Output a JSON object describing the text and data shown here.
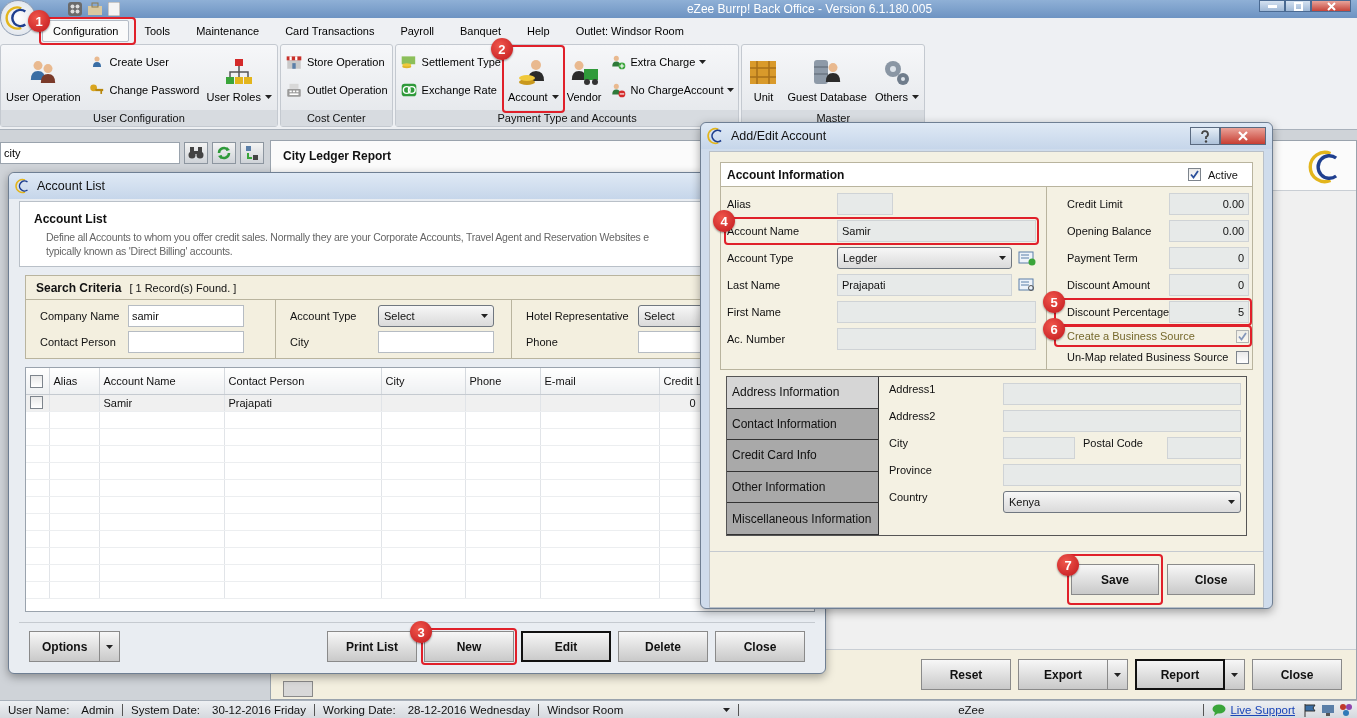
{
  "window": {
    "title": "eZee Burrp! Back Office - Version 6.1.180.005"
  },
  "menu": [
    {
      "label": "Configuration",
      "selected": true,
      "callout": "1"
    },
    {
      "label": "Tools",
      "selected": false
    },
    {
      "label": "Maintenance",
      "selected": false
    },
    {
      "label": "Card Transactions",
      "selected": false
    },
    {
      "label": "Payroll",
      "selected": false
    },
    {
      "label": "Banquet",
      "selected": false
    },
    {
      "label": "Help",
      "selected": false
    },
    {
      "label": "Outlet: Windsor Room",
      "selected": false
    }
  ],
  "ribbon": [
    {
      "title": "User Configuration",
      "items": [
        {
          "label": "User Operation",
          "kind": "large",
          "dropdown": false
        },
        {
          "label": "Create User",
          "kind": "small",
          "dropdown": false
        },
        {
          "label": "Change Password",
          "kind": "small",
          "dropdown": false
        },
        {
          "label": "User Roles",
          "kind": "large",
          "dropdown": true
        }
      ]
    },
    {
      "title": "Cost Center",
      "items": [
        {
          "label": "Store Operation",
          "kind": "small",
          "dropdown": false
        },
        {
          "label": "Outlet Operation",
          "kind": "small",
          "dropdown": false
        }
      ]
    },
    {
      "title": "Payment Type and Accounts",
      "items": [
        {
          "label": "Settlement Type",
          "kind": "small",
          "dropdown": false
        },
        {
          "label": "Exchange Rate",
          "kind": "small",
          "dropdown": false
        },
        {
          "label": "Account",
          "kind": "large",
          "dropdown": true,
          "callout": "2"
        },
        {
          "label": "Vendor",
          "kind": "large",
          "dropdown": false
        },
        {
          "label": "Extra Charge",
          "kind": "small",
          "dropdown": true
        },
        {
          "label": "No ChargeAccount",
          "kind": "small",
          "dropdown": true
        }
      ]
    },
    {
      "title": "Master",
      "items": [
        {
          "label": "Unit",
          "kind": "large",
          "dropdown": false
        },
        {
          "label": "Guest Database",
          "kind": "large",
          "dropdown": false
        },
        {
          "label": "Others",
          "kind": "large",
          "dropdown": true
        }
      ]
    }
  ],
  "search": {
    "value": "city"
  },
  "report_panel": {
    "title": "City Ledger Report",
    "buttons": [
      {
        "label": "Reset",
        "split": false,
        "focused": false
      },
      {
        "label": "Export",
        "split": true,
        "focused": false
      },
      {
        "label": "Report",
        "split": true,
        "focused": true
      },
      {
        "label": "Close",
        "split": false,
        "focused": false
      }
    ]
  },
  "account_list": {
    "title": "Account List",
    "heading": "Account List",
    "description_lines": [
      "Define all Accounts to whom you offer credit sales. Normally they are your Corporate Accounts, Travel Agent and Reservation Websites e",
      "typically known as 'Direct Billing' accounts."
    ],
    "search_criteria": {
      "title": "Search Criteria",
      "count": "[ 1 Record(s) Found. ]",
      "fields": [
        {
          "label": "Company Name",
          "value": "samir",
          "kind": "text"
        },
        {
          "label": "Account Type",
          "value": "Select",
          "kind": "select"
        },
        {
          "label": "Hotel Representative",
          "value": "Select",
          "kind": "select"
        },
        {
          "label": "Contact Person",
          "kind": "text"
        },
        {
          "label": "City",
          "kind": "text"
        },
        {
          "label": "Phone",
          "kind": "text"
        }
      ]
    },
    "table": {
      "select_all_checked": false,
      "columns": [
        "Alias",
        "Account Name",
        "Contact Person",
        "City",
        "Phone",
        "E-mail",
        "Credit L"
      ],
      "rows": [
        {
          "checked": false,
          "cells": [
            null,
            "Samir",
            "Prajapati",
            null,
            null,
            null,
            "0"
          ]
        }
      ]
    },
    "buttons": [
      {
        "label": "Options",
        "split": true,
        "focused": false
      },
      {
        "label": "Print List",
        "split": false,
        "focused": false
      },
      {
        "label": "New",
        "split": false,
        "focused": false,
        "callout": "3"
      },
      {
        "label": "Edit",
        "split": false,
        "focused": true
      },
      {
        "label": "Delete",
        "split": false,
        "focused": false
      },
      {
        "label": "Close",
        "split": false,
        "focused": false
      }
    ]
  },
  "dialog": {
    "title": "Add/Edit Account",
    "section": "Account Information",
    "active": {
      "label": "Active",
      "checked": true
    },
    "left_fields": [
      {
        "label": "Alias",
        "kind": "short"
      },
      {
        "label": "Account Name",
        "value": "Samir",
        "kind": "text",
        "callout": "4"
      },
      {
        "label": "Account Type",
        "value": "Legder",
        "kind": "select-add"
      },
      {
        "label": "Last Name",
        "value": "Prajapati",
        "kind": "text-lookup"
      },
      {
        "label": "First Name",
        "kind": "text"
      },
      {
        "label": "Ac. Number",
        "kind": "text"
      }
    ],
    "right_fields": [
      {
        "label": "Credit Limit",
        "value": "0.00",
        "kind": "number"
      },
      {
        "label": "Opening Balance",
        "value": "0.00",
        "kind": "number"
      },
      {
        "label": "Payment Term",
        "value": "0",
        "kind": "number"
      },
      {
        "label": "Discount Amount",
        "value": "0",
        "kind": "number"
      },
      {
        "label": "Discount Percentage",
        "value": "5",
        "kind": "number",
        "callout": "5"
      },
      {
        "label": "Create a Business Source",
        "kind": "checkbox",
        "checked": true,
        "disabled": true,
        "callout": "6"
      },
      {
        "label": "Un-Map related Business Source",
        "kind": "checkbox",
        "checked": false,
        "disabled": false
      }
    ],
    "tabs": [
      {
        "label": "Address Information",
        "selected": true
      },
      {
        "label": "Contact Information",
        "selected": false
      },
      {
        "label": "Credit Card Info",
        "selected": false
      },
      {
        "label": "Other Information",
        "selected": false
      },
      {
        "label": "Miscellaneous Information",
        "selected": false
      }
    ],
    "address_fields": [
      {
        "label": "Address1",
        "kind": "wide"
      },
      {
        "label": "Address2",
        "kind": "wide"
      },
      {
        "label": "City",
        "kind": "half"
      },
      {
        "label": "Postal Code",
        "kind": "half"
      },
      {
        "label": "Province",
        "kind": "wide"
      },
      {
        "label": "Country",
        "value": "Kenya",
        "kind": "select"
      }
    ],
    "buttons": [
      {
        "label": "Save",
        "callout": "7"
      },
      {
        "label": "Close"
      }
    ]
  },
  "status_bar": {
    "items": [
      {
        "label": "User Name:",
        "value": "Admin"
      },
      {
        "label": "System Date:",
        "value": "30-12-2016 Friday"
      },
      {
        "label": "Working Date:",
        "value": "28-12-2016 Wednesday"
      }
    ],
    "outlet": "Windsor Room",
    "app": "eZee",
    "support": "Live Support"
  }
}
